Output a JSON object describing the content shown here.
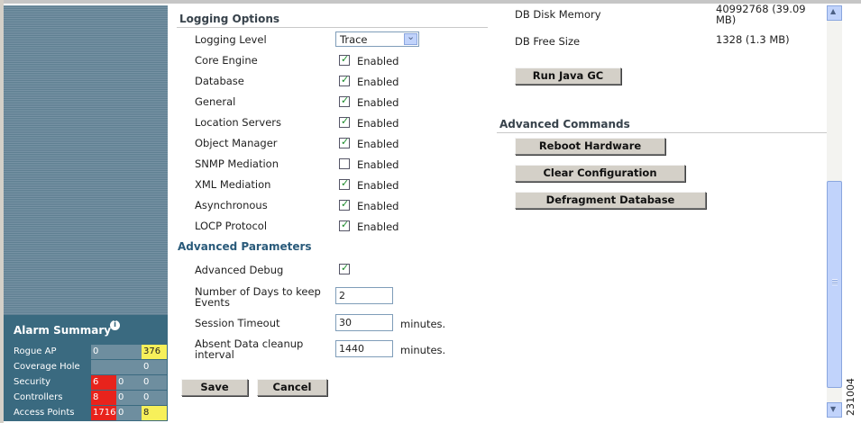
{
  "logging": {
    "title": "Logging Options",
    "level_label": "Logging Level",
    "level_value": "Trace",
    "enabled_text": "Enabled",
    "items": [
      {
        "label": "Core Engine",
        "checked": true
      },
      {
        "label": "Database",
        "checked": true
      },
      {
        "label": "General",
        "checked": true
      },
      {
        "label": "Location Servers",
        "checked": true
      },
      {
        "label": "Object Manager",
        "checked": true
      },
      {
        "label": "SNMP Mediation",
        "checked": false
      },
      {
        "label": "XML Mediation",
        "checked": true
      },
      {
        "label": "Asynchronous",
        "checked": true
      },
      {
        "label": "LOCP Protocol",
        "checked": true
      }
    ]
  },
  "advanced_params": {
    "title": "Advanced Parameters",
    "debug_label": "Advanced Debug",
    "debug_checked": true,
    "days_label": "Number of Days to keep Events",
    "days_value": "2",
    "timeout_label": "Session Timeout",
    "timeout_value": "30",
    "cleanup_label": "Absent Data cleanup interval",
    "cleanup_value": "1440",
    "minutes_unit": "minutes."
  },
  "buttons": {
    "save": "Save",
    "cancel": "Cancel"
  },
  "db_info": {
    "disk_memory_label": "DB Disk Memory",
    "disk_memory_value": "40992768  (39.09 MB)",
    "free_size_label": "DB Free Size",
    "free_size_value": "1328  (1.3 MB)",
    "run_gc": "Run Java GC"
  },
  "advanced_commands": {
    "title": "Advanced Commands",
    "reboot": "Reboot Hardware",
    "clear": "Clear Configuration",
    "defrag": "Defragment Database"
  },
  "alarm_summary": {
    "title": "Alarm Summary",
    "rows": [
      {
        "label": "Rogue AP",
        "values": [
          "0",
          "",
          "376"
        ],
        "colors": [
          "grey",
          "grey",
          "yellow"
        ]
      },
      {
        "label": "Coverage Hole",
        "values": [
          "",
          "",
          "0"
        ],
        "colors": [
          "grey",
          "grey",
          "grey"
        ]
      },
      {
        "label": "Security",
        "values": [
          "6",
          "0",
          "0"
        ],
        "colors": [
          "red",
          "grey",
          "grey"
        ]
      },
      {
        "label": "Controllers",
        "values": [
          "8",
          "0",
          "0"
        ],
        "colors": [
          "red",
          "grey",
          "grey"
        ]
      },
      {
        "label": "Access Points",
        "values": [
          "1716",
          "0",
          "8"
        ],
        "colors": [
          "red",
          "grey",
          "yellow"
        ]
      }
    ]
  },
  "figure_id": "231004"
}
